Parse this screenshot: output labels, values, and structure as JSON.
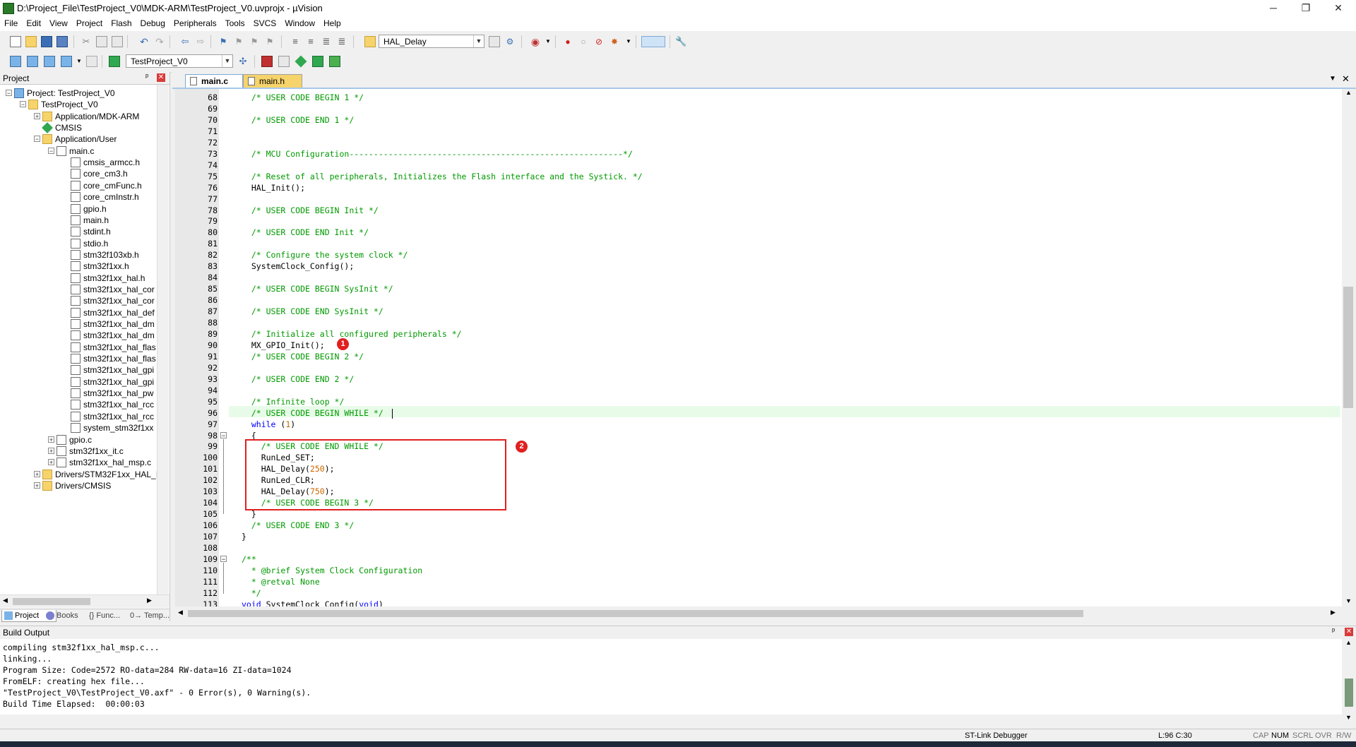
{
  "window": {
    "title": "D:\\Project_File\\TestProject_V0\\MDK-ARM\\TestProject_V0.uvprojx - µVision",
    "minimize": "─",
    "maximize": "❐",
    "close": "✕"
  },
  "menu": [
    "File",
    "Edit",
    "View",
    "Project",
    "Flash",
    "Debug",
    "Peripherals",
    "Tools",
    "SVCS",
    "Window",
    "Help"
  ],
  "toolbar1": {
    "find_combo": "HAL_Delay"
  },
  "toolbar2": {
    "target_combo": "TestProject_V0"
  },
  "project_panel": {
    "title": "Project",
    "pin": "ᵖ",
    "close": "✕",
    "tree": [
      {
        "label": "Project: TestProject_V0",
        "depth": 0,
        "exp": "−",
        "icon": "proj"
      },
      {
        "label": "TestProject_V0",
        "depth": 1,
        "exp": "−",
        "icon": "folder"
      },
      {
        "label": "Application/MDK-ARM",
        "depth": 2,
        "exp": "+",
        "icon": "folder"
      },
      {
        "label": "CMSIS",
        "depth": 2,
        "exp": "",
        "icon": "gem"
      },
      {
        "label": "Application/User",
        "depth": 2,
        "exp": "−",
        "icon": "folder"
      },
      {
        "label": "main.c",
        "depth": 3,
        "exp": "−",
        "icon": "file"
      },
      {
        "label": "cmsis_armcc.h",
        "depth": 4,
        "exp": "",
        "icon": "file"
      },
      {
        "label": "core_cm3.h",
        "depth": 4,
        "exp": "",
        "icon": "file"
      },
      {
        "label": "core_cmFunc.h",
        "depth": 4,
        "exp": "",
        "icon": "file"
      },
      {
        "label": "core_cmInstr.h",
        "depth": 4,
        "exp": "",
        "icon": "file"
      },
      {
        "label": "gpio.h",
        "depth": 4,
        "exp": "",
        "icon": "file"
      },
      {
        "label": "main.h",
        "depth": 4,
        "exp": "",
        "icon": "file"
      },
      {
        "label": "stdint.h",
        "depth": 4,
        "exp": "",
        "icon": "file"
      },
      {
        "label": "stdio.h",
        "depth": 4,
        "exp": "",
        "icon": "file"
      },
      {
        "label": "stm32f103xb.h",
        "depth": 4,
        "exp": "",
        "icon": "file"
      },
      {
        "label": "stm32f1xx.h",
        "depth": 4,
        "exp": "",
        "icon": "file"
      },
      {
        "label": "stm32f1xx_hal.h",
        "depth": 4,
        "exp": "",
        "icon": "file"
      },
      {
        "label": "stm32f1xx_hal_cor",
        "depth": 4,
        "exp": "",
        "icon": "file"
      },
      {
        "label": "stm32f1xx_hal_cor",
        "depth": 4,
        "exp": "",
        "icon": "file"
      },
      {
        "label": "stm32f1xx_hal_def",
        "depth": 4,
        "exp": "",
        "icon": "file"
      },
      {
        "label": "stm32f1xx_hal_dm",
        "depth": 4,
        "exp": "",
        "icon": "file"
      },
      {
        "label": "stm32f1xx_hal_dm",
        "depth": 4,
        "exp": "",
        "icon": "file"
      },
      {
        "label": "stm32f1xx_hal_flas",
        "depth": 4,
        "exp": "",
        "icon": "file"
      },
      {
        "label": "stm32f1xx_hal_flas",
        "depth": 4,
        "exp": "",
        "icon": "file"
      },
      {
        "label": "stm32f1xx_hal_gpi",
        "depth": 4,
        "exp": "",
        "icon": "file"
      },
      {
        "label": "stm32f1xx_hal_gpi",
        "depth": 4,
        "exp": "",
        "icon": "file"
      },
      {
        "label": "stm32f1xx_hal_pw",
        "depth": 4,
        "exp": "",
        "icon": "file"
      },
      {
        "label": "stm32f1xx_hal_rcc",
        "depth": 4,
        "exp": "",
        "icon": "file"
      },
      {
        "label": "stm32f1xx_hal_rcc",
        "depth": 4,
        "exp": "",
        "icon": "file"
      },
      {
        "label": "system_stm32f1xx",
        "depth": 4,
        "exp": "",
        "icon": "file"
      },
      {
        "label": "gpio.c",
        "depth": 3,
        "exp": "+",
        "icon": "file"
      },
      {
        "label": "stm32f1xx_it.c",
        "depth": 3,
        "exp": "+",
        "icon": "file"
      },
      {
        "label": "stm32f1xx_hal_msp.c",
        "depth": 3,
        "exp": "+",
        "icon": "file"
      },
      {
        "label": "Drivers/STM32F1xx_HAL_I",
        "depth": 2,
        "exp": "+",
        "icon": "folder"
      },
      {
        "label": "Drivers/CMSIS",
        "depth": 2,
        "exp": "+",
        "icon": "folder"
      }
    ],
    "tabs": [
      "Project",
      "Books",
      "{} Func...",
      "0→ Temp..."
    ]
  },
  "editor_tabs": [
    "main.c",
    "main.h"
  ],
  "editor": {
    "lines": [
      {
        "n": "68",
        "t": "  /* USER CODE BEGIN 1 */",
        "c": "cm"
      },
      {
        "n": "69",
        "t": "",
        "c": ""
      },
      {
        "n": "70",
        "t": "  /* USER CODE END 1 */",
        "c": "cm"
      },
      {
        "n": "71",
        "t": "",
        "c": ""
      },
      {
        "n": "72",
        "t": "",
        "c": ""
      },
      {
        "n": "73",
        "t": "  /* MCU Configuration--------------------------------------------------------*/",
        "c": "cm"
      },
      {
        "n": "74",
        "t": "",
        "c": ""
      },
      {
        "n": "75",
        "t": "  /* Reset of all peripherals, Initializes the Flash interface and the Systick. */",
        "c": "cm"
      },
      {
        "n": "76",
        "t": "  HAL_Init();",
        "c": ""
      },
      {
        "n": "77",
        "t": "",
        "c": ""
      },
      {
        "n": "78",
        "t": "  /* USER CODE BEGIN Init */",
        "c": "cm"
      },
      {
        "n": "79",
        "t": "",
        "c": ""
      },
      {
        "n": "80",
        "t": "  /* USER CODE END Init */",
        "c": "cm"
      },
      {
        "n": "81",
        "t": "",
        "c": ""
      },
      {
        "n": "82",
        "t": "  /* Configure the system clock */",
        "c": "cm"
      },
      {
        "n": "83",
        "t": "  SystemClock_Config();",
        "c": ""
      },
      {
        "n": "84",
        "t": "",
        "c": ""
      },
      {
        "n": "85",
        "t": "  /* USER CODE BEGIN SysInit */",
        "c": "cm"
      },
      {
        "n": "86",
        "t": "",
        "c": ""
      },
      {
        "n": "87",
        "t": "  /* USER CODE END SysInit */",
        "c": "cm"
      },
      {
        "n": "88",
        "t": "",
        "c": ""
      },
      {
        "n": "89",
        "t": "  /* Initialize all configured peripherals */",
        "c": "cm"
      },
      {
        "n": "90",
        "t": "  MX_GPIO_Init();",
        "c": ""
      },
      {
        "n": "91",
        "t": "  /* USER CODE BEGIN 2 */",
        "c": "cm"
      },
      {
        "n": "92",
        "t": "",
        "c": ""
      },
      {
        "n": "93",
        "t": "  /* USER CODE END 2 */",
        "c": "cm"
      },
      {
        "n": "94",
        "t": "",
        "c": ""
      },
      {
        "n": "95",
        "t": "  /* Infinite loop */",
        "c": "cm"
      },
      {
        "n": "96",
        "t": "  /* USER CODE BEGIN WHILE */",
        "c": "cm"
      },
      {
        "n": "97",
        "t": "  while (1)",
        "c": "while"
      },
      {
        "n": "98",
        "t": "  {",
        "c": ""
      },
      {
        "n": "99",
        "t": "    /* USER CODE END WHILE */",
        "c": "cm"
      },
      {
        "n": "100",
        "t": "    RunLed_SET;",
        "c": ""
      },
      {
        "n": "101",
        "t": "    HAL_Delay(250);",
        "c": "d250"
      },
      {
        "n": "102",
        "t": "    RunLed_CLR;",
        "c": ""
      },
      {
        "n": "103",
        "t": "    HAL_Delay(750);",
        "c": "d750"
      },
      {
        "n": "104",
        "t": "    /* USER CODE BEGIN 3 */",
        "c": "cm"
      },
      {
        "n": "105",
        "t": "  }",
        "c": ""
      },
      {
        "n": "106",
        "t": "  /* USER CODE END 3 */",
        "c": "cm"
      },
      {
        "n": "107",
        "t": "}",
        "c": ""
      },
      {
        "n": "108",
        "t": "",
        "c": ""
      },
      {
        "n": "109",
        "t": "/**",
        "c": "cm"
      },
      {
        "n": "110",
        "t": "  * @brief System Clock Configuration",
        "c": "cm"
      },
      {
        "n": "111",
        "t": "  * @retval None",
        "c": "cm"
      },
      {
        "n": "112",
        "t": "  */",
        "c": "cm"
      },
      {
        "n": "113",
        "t": "void SystemClock_Config(void)",
        "c": "void"
      }
    ],
    "badge1": "1",
    "badge2": "2"
  },
  "build_output": {
    "title": "Build Output",
    "lines": [
      "compiling stm32f1xx_hal_msp.c...",
      "linking...",
      "Program Size: Code=2572 RO-data=284 RW-data=16 ZI-data=1024",
      "FromELF: creating hex file...",
      "\"TestProject_V0\\TestProject_V0.axf\" - 0 Error(s), 0 Warning(s).",
      "Build Time Elapsed:  00:00:03"
    ]
  },
  "status": {
    "debugger": "ST-Link Debugger",
    "position": "L:96 C:30",
    "cap": "CAP",
    "num": "NUM",
    "scrl": "SCRL",
    "ovr": "OVR",
    "rw": "R/W"
  },
  "colors": {
    "comment": "#009900",
    "keyword": "#0000ff",
    "number": "#cc6600",
    "annotation": "#e02020"
  }
}
